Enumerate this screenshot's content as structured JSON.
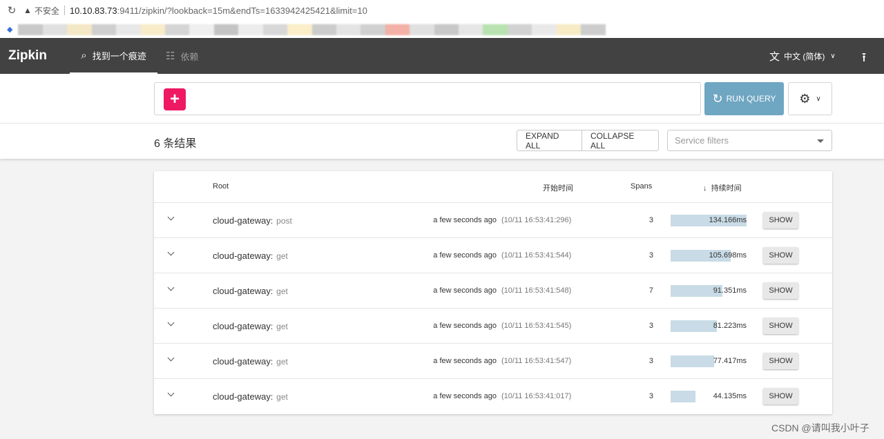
{
  "browser": {
    "insecure_label": "不安全",
    "url_host": "10.10.83.73",
    "url_rest": ":9411/zipkin/?lookback=15m&endTs=1633942425421&limit=10"
  },
  "header": {
    "logo": "Zipkin",
    "tabs": [
      {
        "label": "找到一个痕迹",
        "icon": "search-icon"
      },
      {
        "label": "依赖",
        "icon": "dependency-icon"
      }
    ],
    "language": "中文 (简体)"
  },
  "query": {
    "run_label": "RUN QUERY"
  },
  "results": {
    "count_label": "6 条结果",
    "expand_all": "EXPAND ALL",
    "collapse_all": "COLLAPSE ALL",
    "service_filter_placeholder": "Service filters"
  },
  "table": {
    "headers": {
      "root": "Root",
      "start_time": "开始时间",
      "spans": "Spans",
      "duration": "持续时间"
    },
    "show_label": "SHOW",
    "rows": [
      {
        "service": "cloud-gateway",
        "operation": "post",
        "relative": "a few seconds ago",
        "timestamp": "(10/11 16:53:41:296)",
        "spans": "3",
        "duration": "134.166ms",
        "duration_fraction": 1.0
      },
      {
        "service": "cloud-gateway",
        "operation": "get",
        "relative": "a few seconds ago",
        "timestamp": "(10/11 16:53:41:544)",
        "spans": "3",
        "duration": "105.698ms",
        "duration_fraction": 0.788
      },
      {
        "service": "cloud-gateway",
        "operation": "get",
        "relative": "a few seconds ago",
        "timestamp": "(10/11 16:53:41:548)",
        "spans": "7",
        "duration": "91.351ms",
        "duration_fraction": 0.681
      },
      {
        "service": "cloud-gateway",
        "operation": "get",
        "relative": "a few seconds ago",
        "timestamp": "(10/11 16:53:41:545)",
        "spans": "3",
        "duration": "81.223ms",
        "duration_fraction": 0.605
      },
      {
        "service": "cloud-gateway",
        "operation": "get",
        "relative": "a few seconds ago",
        "timestamp": "(10/11 16:53:41:547)",
        "spans": "3",
        "duration": "77.417ms",
        "duration_fraction": 0.577
      },
      {
        "service": "cloud-gateway",
        "operation": "get",
        "relative": "a few seconds ago",
        "timestamp": "(10/11 16:53:41:017)",
        "spans": "3",
        "duration": "44.135ms",
        "duration_fraction": 0.329
      }
    ]
  },
  "watermark": "CSDN @请叫我小叶子",
  "colors": {
    "header_bg": "#424242",
    "accent_pink": "#ee1863",
    "run_button": "#6fa6c2",
    "duration_bar": "#c8dbe6"
  }
}
